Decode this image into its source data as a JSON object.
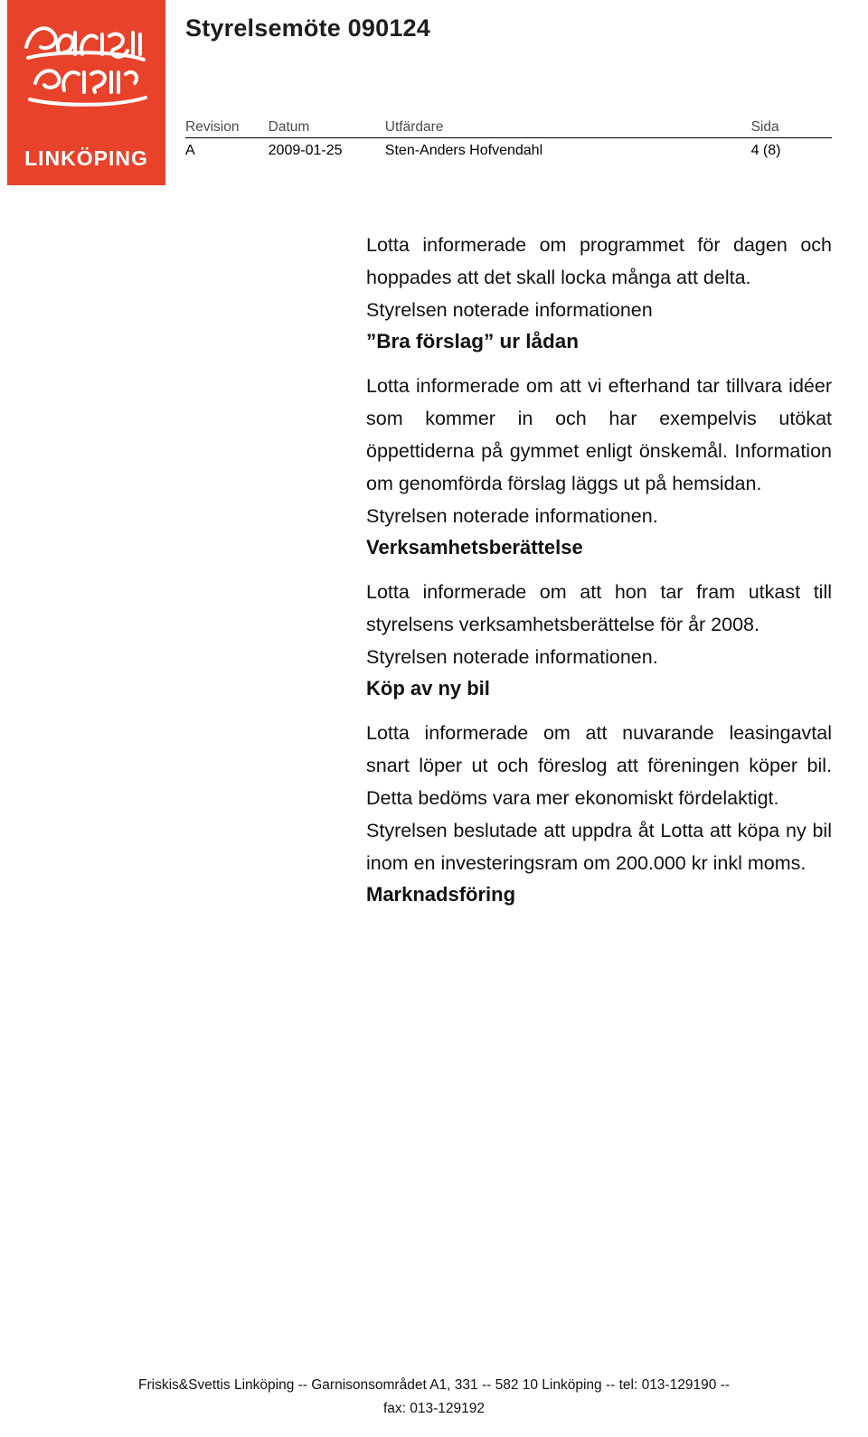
{
  "header": {
    "title": "Styrelsemöte 090124",
    "logo": {
      "brand": "Friskis&Svettis",
      "city": "LINKÖPING",
      "color": "#e8422a"
    },
    "meta": {
      "columns": [
        "Revision",
        "Datum",
        "Utfärdare",
        "Sida"
      ],
      "values": [
        "A",
        "2009-01-25",
        "Sten-Anders Hofvendahl",
        "4 (8)"
      ]
    }
  },
  "body": {
    "blocks": [
      {
        "type": "paragraph",
        "text": "Lotta informerade om programmet för dagen och hoppades att det skall locka många att delta."
      },
      {
        "type": "paragraph",
        "text": "Styrelsen noterade informationen"
      },
      {
        "type": "heading",
        "text": "”Bra förslag” ur lådan"
      },
      {
        "type": "paragraph",
        "text": "Lotta informerade om att vi efterhand tar tillvara idéer som kommer in och har exempelvis utökat öppettiderna på gymmet enligt önskemål. Information om genomförda förslag läggs ut på hemsidan."
      },
      {
        "type": "paragraph",
        "text": "Styrelsen noterade informationen."
      },
      {
        "type": "heading",
        "text": "Verksamhetsberättelse"
      },
      {
        "type": "paragraph",
        "text": "Lotta informerade om att hon tar fram utkast till styrelsens verksamhetsberättelse för år 2008."
      },
      {
        "type": "paragraph",
        "text": "Styrelsen noterade informationen."
      },
      {
        "type": "heading",
        "text": "Köp av ny bil"
      },
      {
        "type": "paragraph",
        "text": "Lotta informerade om att nuvarande leasingavtal snart löper ut och föreslog att föreningen köper bil. Detta bedöms vara mer ekonomiskt fördelaktigt."
      },
      {
        "type": "paragraph",
        "text": "Styrelsen beslutade att uppdra åt Lotta att köpa ny bil inom en investeringsram om 200.000 kr inkl moms."
      },
      {
        "type": "heading",
        "text": "Marknadsföring"
      }
    ]
  },
  "footer": {
    "line1": "Friskis&Svettis Linköping  --  Garnisonsområdet A1, 331  --  582 10 Linköping  --  tel: 013-129190  --",
    "line2": "fax: 013-129192"
  }
}
